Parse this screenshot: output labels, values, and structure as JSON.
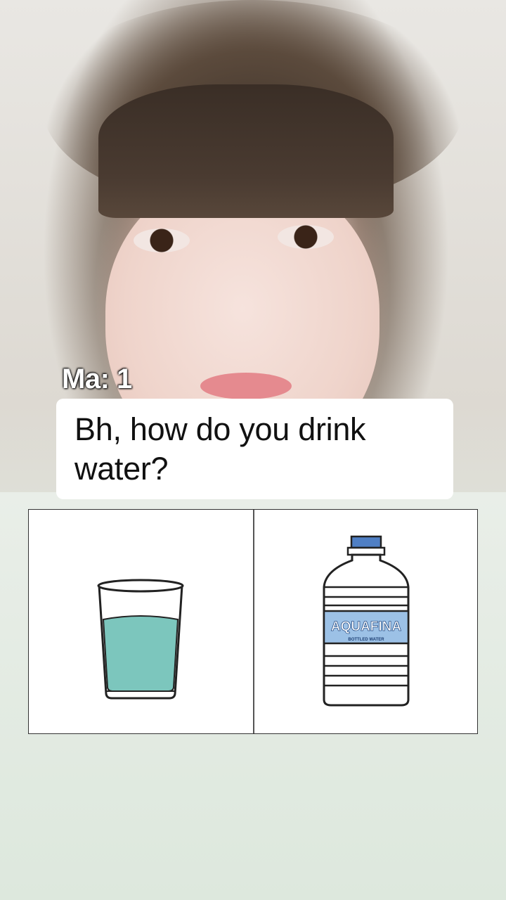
{
  "caption": {
    "speaker": "Ma: 1",
    "question": "Bh, how do you drink\n water?"
  },
  "choices": [
    {
      "id": "glass",
      "icon": "water-glass-icon",
      "water_color": "#7cc6bd"
    },
    {
      "id": "bottle",
      "icon": "water-bottle-icon",
      "label_color": "#9cc1e6",
      "cap_color": "#4f7fc4",
      "brand": "AQUAFINA",
      "subtext": "BOTTLED WATER"
    }
  ]
}
